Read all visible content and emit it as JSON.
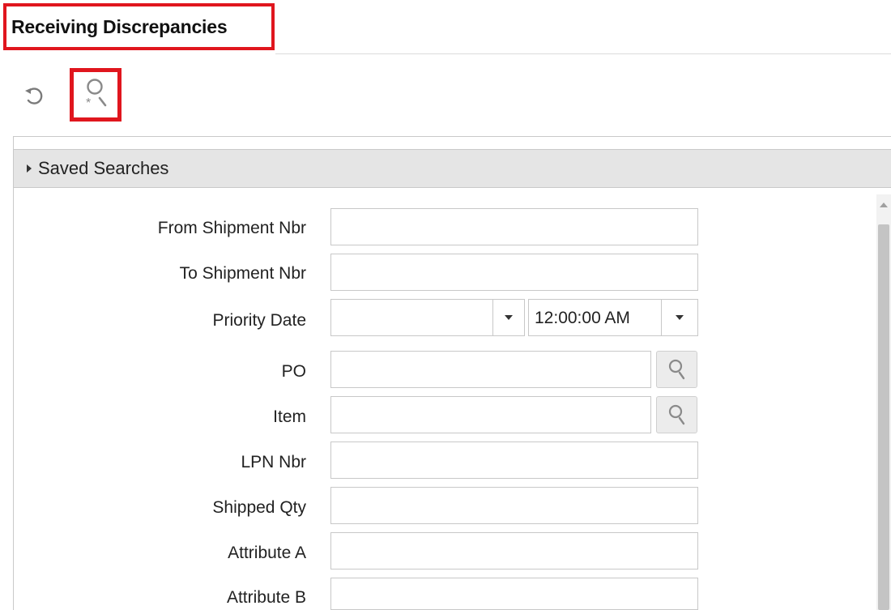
{
  "page": {
    "title": "Receiving Discrepancies"
  },
  "toolbar": {
    "refresh_icon": "refresh-icon",
    "find_icon": "search-advanced-icon"
  },
  "saved_searches": {
    "label": "Saved Searches"
  },
  "form": {
    "from_shipment_nbr": {
      "label": "From Shipment Nbr",
      "value": ""
    },
    "to_shipment_nbr": {
      "label": "To Shipment Nbr",
      "value": ""
    },
    "priority_date": {
      "label": "Priority Date",
      "date_value": "",
      "time_value": "12:00:00 AM"
    },
    "po": {
      "label": "PO",
      "value": ""
    },
    "item": {
      "label": "Item",
      "value": ""
    },
    "lpn_nbr": {
      "label": "LPN Nbr",
      "value": ""
    },
    "shipped_qty": {
      "label": "Shipped Qty",
      "value": ""
    },
    "attribute_a": {
      "label": "Attribute A",
      "value": ""
    },
    "attribute_b": {
      "label": "Attribute B",
      "value": ""
    }
  },
  "colors": {
    "highlight": "#e0161e",
    "header_bg": "#e5e5e5",
    "border": "#c8c8c8"
  }
}
